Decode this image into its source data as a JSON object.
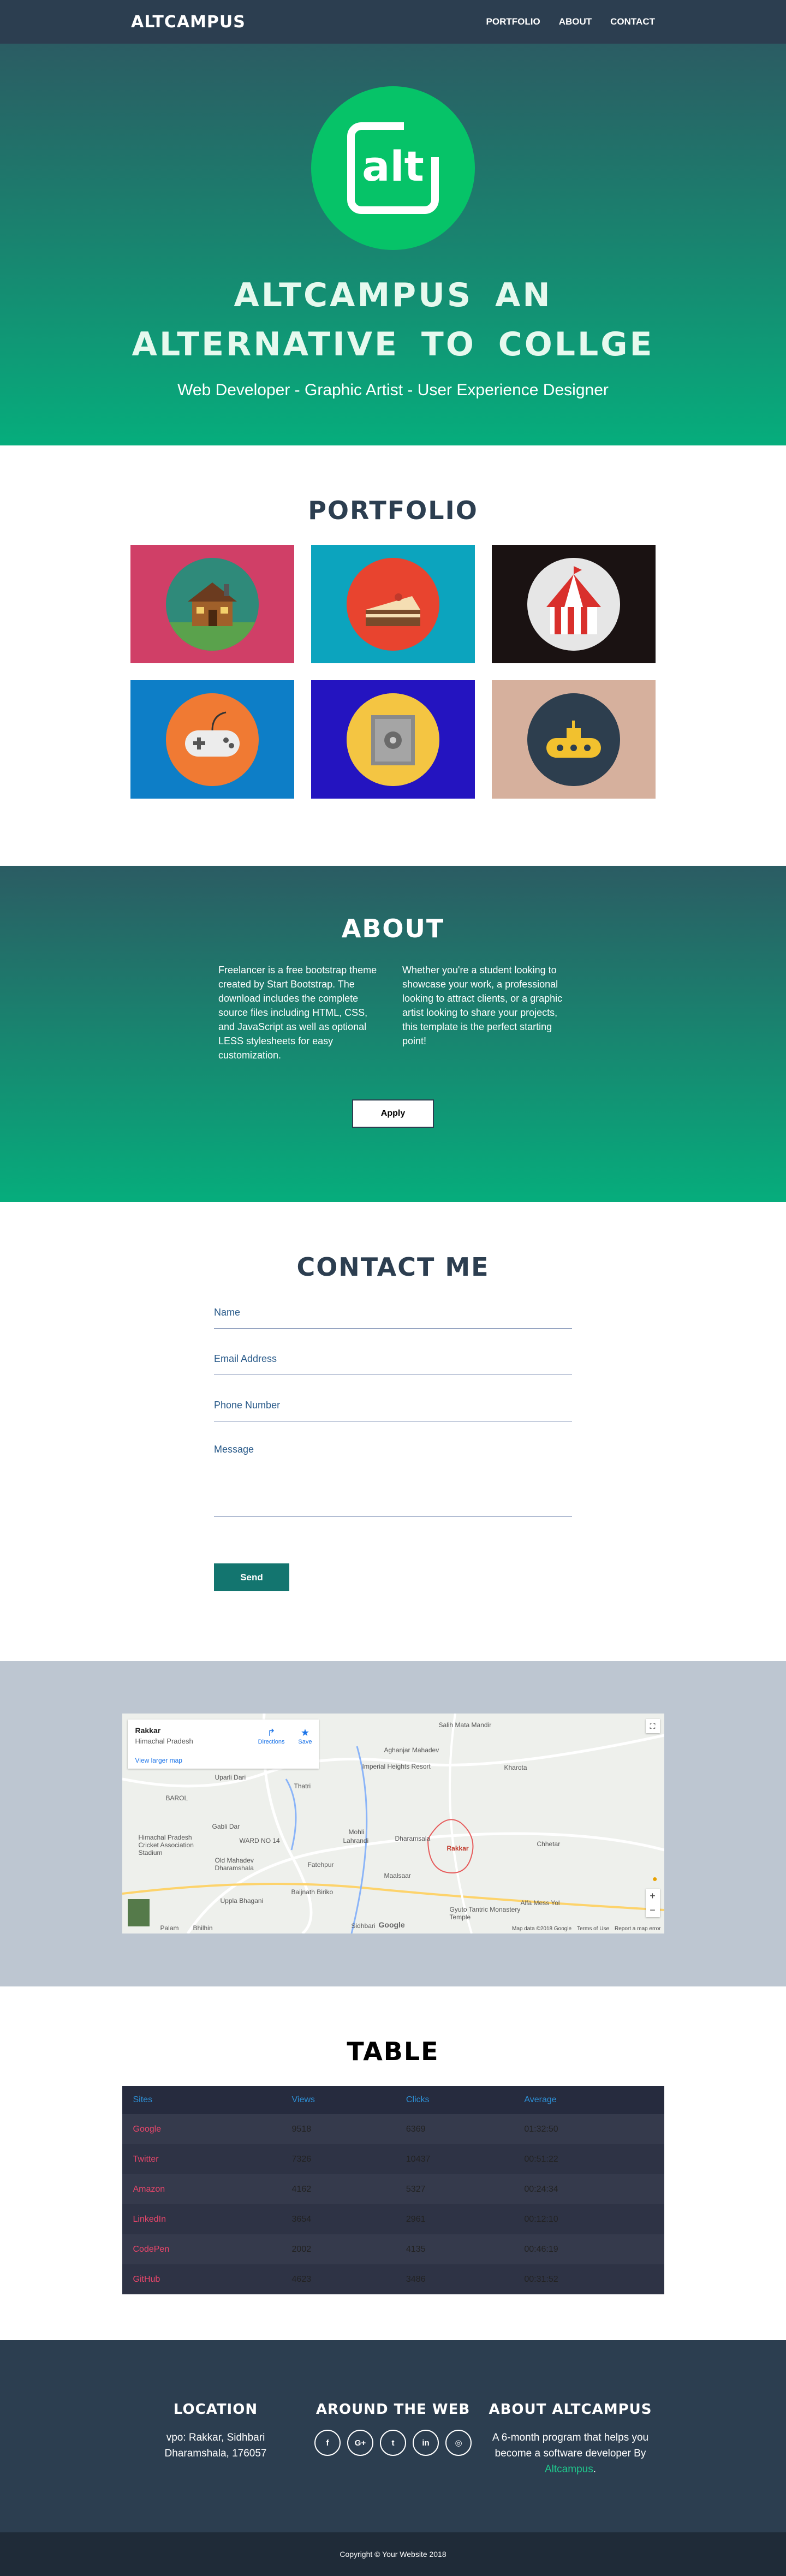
{
  "nav": {
    "brand": "ALTCAMPUS",
    "links": [
      "PORTFOLIO",
      "ABOUT",
      "CONTACT"
    ]
  },
  "hero": {
    "logo_text": "alt",
    "title": "ALTCAMPUS AN ALTERNATIVE TO COLLGE",
    "tagline": "Web Developer - Graphic Artist - User Experience Designer"
  },
  "portfolio": {
    "title": "PORTFOLIO",
    "tiles": [
      {
        "icon": "cabin-icon",
        "bg": "#d03f67"
      },
      {
        "icon": "cake-icon",
        "bg": "#0ca4be"
      },
      {
        "icon": "circus-tent-icon",
        "bg": "#1a1212"
      },
      {
        "icon": "game-controller-icon",
        "bg": "#0d7ec7"
      },
      {
        "icon": "safe-icon",
        "bg": "#2414c0"
      },
      {
        "icon": "submarine-icon",
        "bg": "#d6b09d"
      }
    ]
  },
  "about": {
    "title": "ABOUT",
    "col1": "Freelancer is a free bootstrap theme created by Start Bootstrap. The download includes the complete source files including HTML, CSS, and JavaScript as well as optional LESS stylesheets for easy customization.",
    "col2": "Whether you're a student looking to showcase your work, a professional looking to attract clients, or a graphic artist looking to share your projects, this template is the perfect starting point!",
    "button": "Apply"
  },
  "contact": {
    "title": "CONTACT ME",
    "name_placeholder": "Name",
    "email_placeholder": "Email Address",
    "phone_placeholder": "Phone Number",
    "message_placeholder": "Message",
    "send": "Send"
  },
  "map": {
    "place": "Rakkar",
    "region": "Himachal Pradesh",
    "larger_map": "View larger map",
    "directions": "Directions",
    "save": "Save",
    "labels": [
      "Salih Mata Mandir",
      "Aghanjar Mahadev",
      "Imperial Heights Resort",
      "Kharota",
      "Uparli Dari",
      "Thatri",
      "BAROL",
      "Gabli Dar",
      "WARD NO 14",
      "Himachal Pradesh Cricket Association Stadium",
      "Mohli",
      "Lahrandi",
      "Dharamsala",
      "Rakkar",
      "Maalsaar",
      "Chhetar",
      "Old Mahadev Dharamshala",
      "Fatehpur",
      "Sidhbari",
      "Gyuto Tantric Monastery Temple",
      "Uppla Bhagani",
      "Palam",
      "Bhilhin",
      "Alfa Mess Yol",
      "Baijnath Biriko",
      "Alfa Mess Yol"
    ],
    "google": "Google",
    "footer": [
      "Map data ©2018 Google",
      "Terms of Use",
      "Report a map error"
    ]
  },
  "table": {
    "title": "TABLE",
    "headers": [
      "Sites",
      "Views",
      "Clicks",
      "Average"
    ],
    "rows": [
      [
        "Google",
        "9518",
        "6369",
        "01:32:50"
      ],
      [
        "Twitter",
        "7326",
        "10437",
        "00:51:22"
      ],
      [
        "Amazon",
        "4162",
        "5327",
        "00:24:34"
      ],
      [
        "LinkedIn",
        "3654",
        "2961",
        "00:12:10"
      ],
      [
        "CodePen",
        "2002",
        "4135",
        "00:46:19"
      ],
      [
        "GitHub",
        "4623",
        "3486",
        "00:31:52"
      ]
    ]
  },
  "footer": {
    "location_title": "LOCATION",
    "location_line1": "vpo: Rakkar, Sidhbari",
    "location_line2": "Dharamshala, 176057",
    "web_title": "AROUND THE WEB",
    "socials": [
      "f",
      "G+",
      "t",
      "in",
      "◎"
    ],
    "about_title": "ABOUT ALTCAMPUS",
    "about_text": "A 6-month program that helps you become a software developer By",
    "about_link": "Altcampus",
    "copyright": "Copyright © Your Website 2018"
  }
}
